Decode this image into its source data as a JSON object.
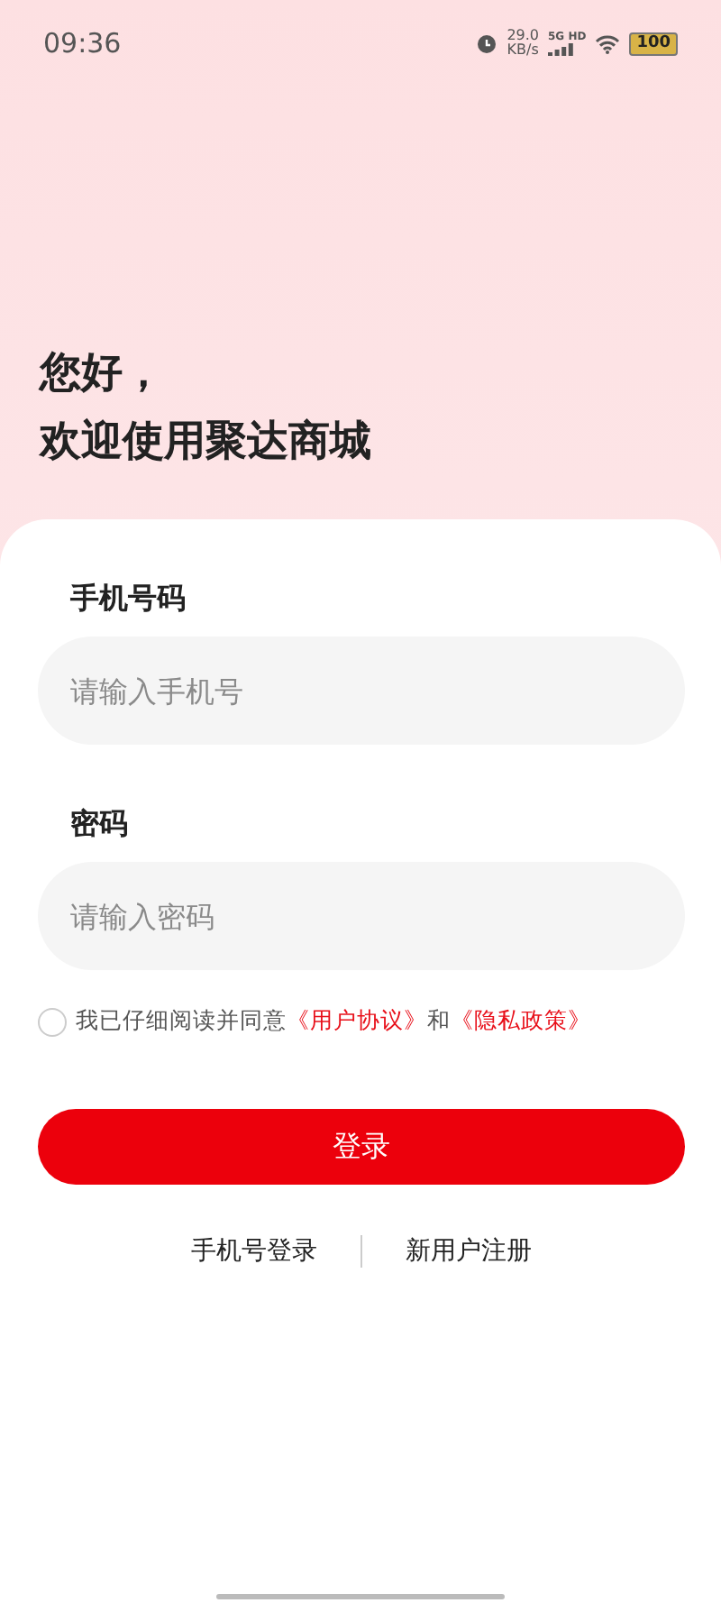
{
  "status_bar": {
    "time": "09:36",
    "speed_value": "29.0",
    "speed_unit": "KB/s",
    "network": "5G HD",
    "battery": "100"
  },
  "greeting": [
    "您好，",
    "欢迎使用聚达商城"
  ],
  "fields": [
    {
      "label": "手机号码",
      "placeholder": "请输入手机号"
    },
    {
      "label": "密码",
      "placeholder": "请输入密码"
    }
  ],
  "agreement": {
    "checked": false,
    "parts": [
      {
        "kind": "text",
        "text": "我已仔细阅读并同意"
      },
      {
        "kind": "link",
        "text": "《用户协议》"
      },
      {
        "kind": "text",
        "text": "和"
      },
      {
        "kind": "link",
        "text": "《隐私政策》"
      }
    ]
  },
  "login_button": "登录",
  "bottom_links": [
    "手机号登录",
    "新用户注册"
  ]
}
